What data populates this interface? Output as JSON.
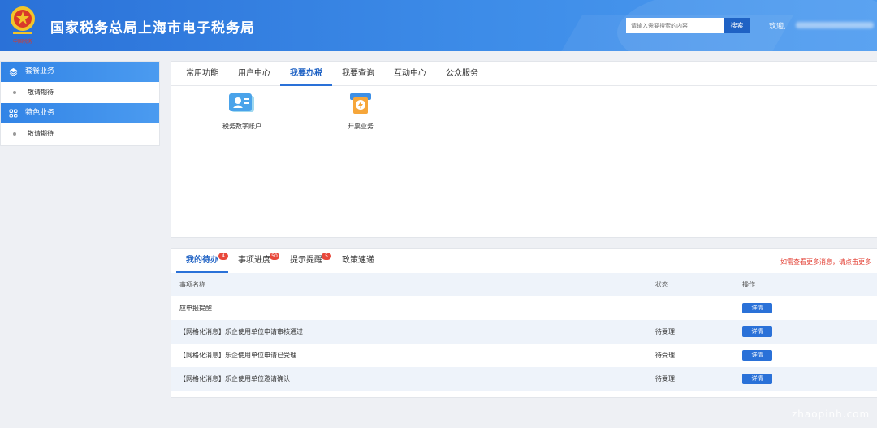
{
  "header": {
    "title": "国家税务总局上海市电子税务局",
    "emblem_text": "中国税务",
    "search_placeholder": "请输入需要搜索的内容",
    "search_button": "搜索",
    "welcome": "欢迎,"
  },
  "sidebar": {
    "sections": [
      {
        "title": "套餐业务",
        "icon": "layers-icon",
        "items": [
          "敬请期待"
        ]
      },
      {
        "title": "特色业务",
        "icon": "grid-icon",
        "items": [
          "敬请期待"
        ]
      }
    ]
  },
  "main": {
    "tabs": [
      "常用功能",
      "用户中心",
      "我要办税",
      "我要查询",
      "互动中心",
      "公众服务"
    ],
    "active_tab": "我要办税",
    "services": [
      {
        "label": "税务数字账户",
        "icon": "digital-account-icon"
      },
      {
        "label": "开票业务",
        "icon": "invoice-icon"
      }
    ]
  },
  "todo": {
    "tabs": [
      {
        "label": "我的待办",
        "badge": "4"
      },
      {
        "label": "事项进度",
        "badge": "50"
      },
      {
        "label": "提示提醒",
        "badge": "5"
      },
      {
        "label": "政策速递",
        "badge": ""
      }
    ],
    "more_hint": "如需查看更多消息，请点击更多",
    "columns": {
      "name": "事项名称",
      "status": "状态",
      "op": "操作"
    },
    "rows": [
      {
        "name": "应申报提醒",
        "status": "",
        "action": "详情"
      },
      {
        "name": "【网格化消息】乐企使用单位申请审核通过",
        "status": "待受理",
        "action": "详情"
      },
      {
        "name": "【网格化消息】乐企使用单位申请已受理",
        "status": "待受理",
        "action": "详情"
      },
      {
        "name": "【网格化消息】乐企使用单位邀请确认",
        "status": "待受理",
        "action": "详情"
      }
    ]
  },
  "watermark": "zhaopinh.com",
  "colors": {
    "brand": "#2a71d8",
    "badge": "#e8483b",
    "hint": "#e23b2f"
  }
}
